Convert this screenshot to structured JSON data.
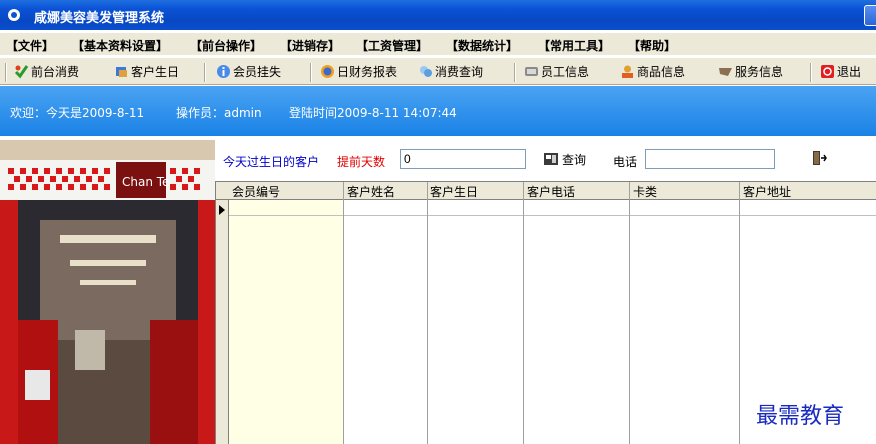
{
  "window": {
    "title": "咸娜美容美发管理系统"
  },
  "menu": [
    "【文件】",
    "【基本资料设置】",
    "【前台操作】",
    "【进销存】",
    "【工资管理】",
    "【数据统计】",
    "【常用工具】",
    "【帮助】"
  ],
  "toolbar": {
    "front_consume": "前台消费",
    "birthday": "客户生日",
    "member_loss": "会员挂失",
    "daily_report": "日财务报表",
    "consume_query": "消费查询",
    "staff_info": "员工信息",
    "goods_info": "商品信息",
    "service_info": "服务信息",
    "exit": "退出"
  },
  "banner": {
    "welcome": "欢迎：今天是2009-8-11",
    "operator": "操作员：admin",
    "login_time": "登陆时间2009-8-11 14:07:44"
  },
  "photo": {
    "sign": "Chan Te"
  },
  "search": {
    "today_label": "今天过生日的客户",
    "advance_label": "提前天数",
    "advance_value": "0",
    "query_button": "查询",
    "phone_label": "电话",
    "phone_value": ""
  },
  "grid": {
    "columns": [
      "会员编号",
      "客户姓名",
      "客户生日",
      "客户电话",
      "卡类",
      "客户地址"
    ]
  },
  "watermark": "最需教育",
  "colors": {
    "title_bar": "#0a52d6",
    "banner": "#1a82e6",
    "advance_label": "#e00000",
    "today_label": "#0000cc"
  }
}
